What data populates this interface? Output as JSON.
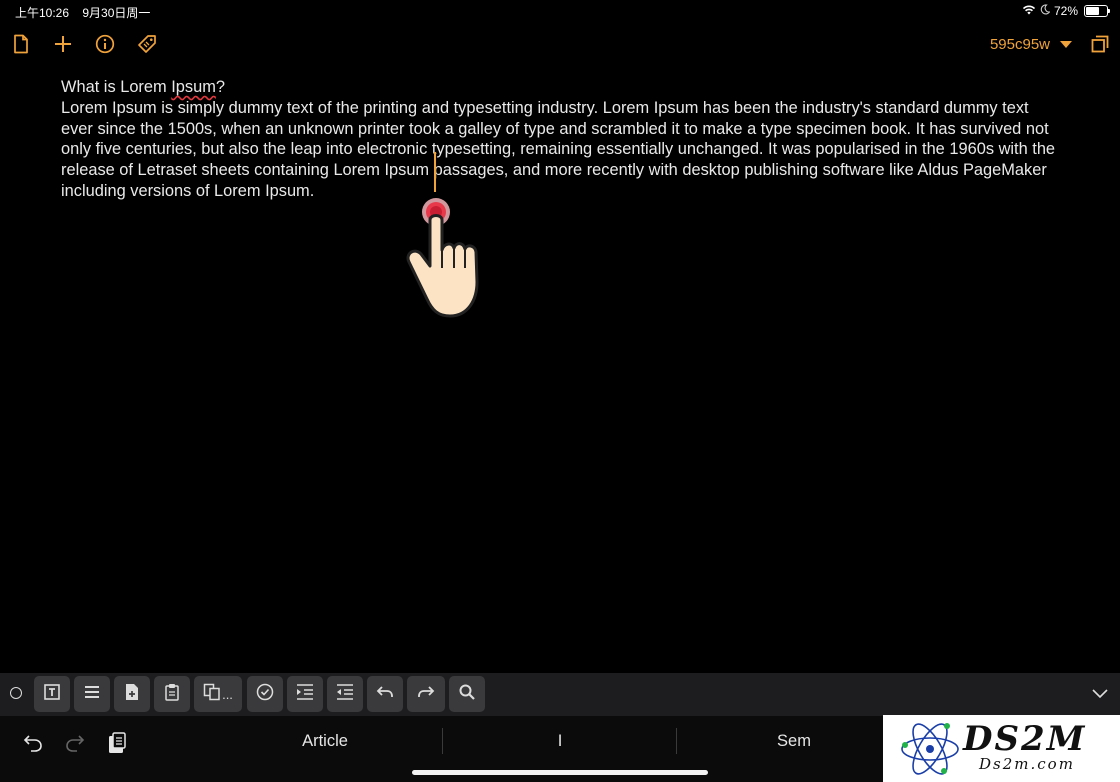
{
  "status_bar": {
    "time": "上午10:26",
    "date": "9月30日周一",
    "battery_percent": "72%",
    "battery_level": 0.72
  },
  "toolbar": {
    "icons": [
      "document-icon",
      "plus-icon",
      "info-icon",
      "tag-icon",
      "expand-icon"
    ],
    "document_name": "595c95w",
    "accent_color": "#f0a23b"
  },
  "editor": {
    "heading_prefix": "What is Lorem ",
    "heading_misspelled": "Ipsum",
    "heading_suffix": "?",
    "body": "Lorem Ipsum is simply dummy text of the printing and typesetting industry. Lorem Ipsum has been the industry's standard dummy text ever since the 1500s, when an unknown printer took a galley of type and scrambled it to make a type specimen book. It has survived not only five centuries, but also the leap into electronic typesetting, remaining essentially unchanged. It was popularised in the 1960s with the release of Letraset sheets containing Lorem Ipsum passages, and more recently with desktop publishing software like Aldus PageMaker including versions of Lorem Ipsum."
  },
  "format_bar": {
    "buttons": [
      "text-box-icon",
      "list-icon",
      "new-document-icon",
      "clipboard-icon",
      "copy-more-icon",
      "checkbox-icon",
      "indent-icon",
      "outdent-icon",
      "undo-icon",
      "redo-icon",
      "search-icon"
    ],
    "copy_more_ellipsis": "..."
  },
  "keyboard_bar": {
    "suggestions": [
      "Article",
      "I",
      "Sem"
    ]
  },
  "watermark": {
    "text": "DS2M",
    "subtext": "Ds2m.com"
  }
}
